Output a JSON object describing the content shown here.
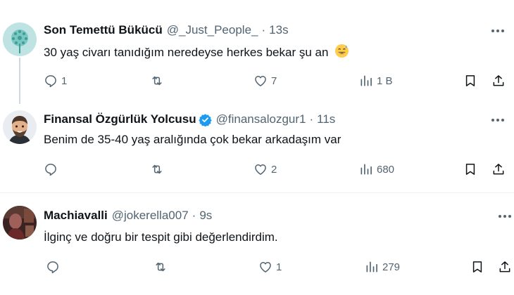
{
  "tweets": [
    {
      "name": "Son Temettü Bükücü",
      "handle": "@_Just_People_",
      "dot": "·",
      "time": "13s",
      "text": "30 yaş civarı tanıdığım neredeyse herkes bekar şu an",
      "emoji": "😅",
      "replies": "1",
      "retweets": "",
      "likes": "7",
      "views": "1 B"
    },
    {
      "name": "Finansal Özgürlük Yolcusu",
      "handle": "@finansalozgur1",
      "dot": "·",
      "time": "11s",
      "text": "Benim de 35-40 yaş aralığında çok bekar arkadaşım var",
      "replies": "",
      "retweets": "",
      "likes": "2",
      "views": "680"
    },
    {
      "name": "Machiavalli",
      "handle": "@jokerella007",
      "dot": "·",
      "time": "9s",
      "text": "İlginç ve doğru bir tespit gibi değerlendirdim.",
      "replies": "",
      "retweets": "",
      "likes": "1",
      "views": "279"
    }
  ],
  "colors": {
    "text": "#0f1419",
    "muted": "#536471",
    "verified": "#1d9bf0",
    "divider": "#eff3f4"
  },
  "icons": [
    "reply-icon",
    "retweet-icon",
    "like-icon",
    "views-icon",
    "bookmark-icon",
    "share-icon",
    "more-icon",
    "verified-badge-icon"
  ]
}
